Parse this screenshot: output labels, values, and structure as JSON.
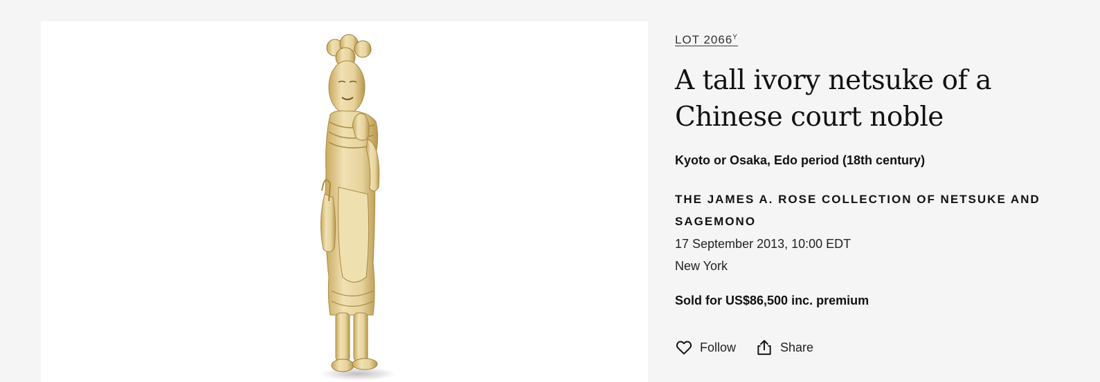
{
  "lot": {
    "number": "LOT 2066",
    "superscript": "Y"
  },
  "title": "A tall ivory netsuke of a Chinese court noble",
  "subtitle": "Kyoto or Osaka, Edo period (18th century)",
  "sale": {
    "name": "THE JAMES A. ROSE COLLECTION OF NETSUKE AND SAGEMONO",
    "date": "17 September 2013, 10:00 EDT",
    "location": "New York"
  },
  "sold_for": "Sold for US$86,500 inc. premium",
  "actions": {
    "follow_label": "Follow",
    "follow_icon": "heart-icon",
    "share_label": "Share",
    "share_icon": "share-icon"
  },
  "colors": {
    "page_background": "#f5f5f5",
    "image_background": "#ffffff",
    "ivory": "#e8d7a6",
    "ivory_shadow": "#b89a52"
  }
}
